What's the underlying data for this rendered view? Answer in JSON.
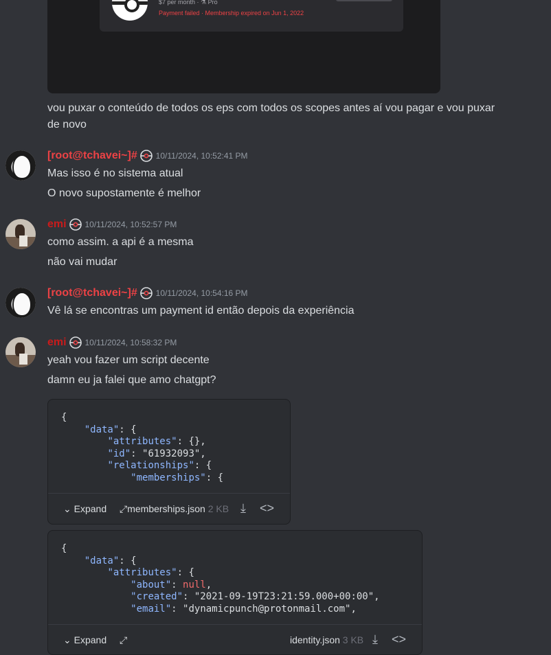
{
  "embed": {
    "price_line": "$7 per month · ",
    "tier": "Pro",
    "error_line": "Payment failed · Membership expired on Jun 1, 2022"
  },
  "messages": [
    {
      "id": "m0",
      "lines": [
        "vou puxar o conteúdo de todos os eps com todos os scopes antes aí vou pagar e vou puxar",
        "de novo"
      ]
    },
    {
      "id": "m1",
      "author": "[root@tchavei~]#",
      "timestamp": "10/11/2024, 10:52:41 PM",
      "lines": [
        "Mas isso é no sistema atual",
        "O novo supostamente é melhor"
      ]
    },
    {
      "id": "m2",
      "author": "emi",
      "timestamp": "10/11/2024, 10:52:57 PM",
      "lines": [
        "como assim. a api é a mesma",
        "não vai mudar"
      ]
    },
    {
      "id": "m3",
      "author": "[root@tchavei~]#",
      "timestamp": "10/11/2024, 10:54:16 PM",
      "lines": [
        "Vê lá se encontras um payment id então depois da experiência"
      ]
    },
    {
      "id": "m4",
      "author": "emi",
      "timestamp": "10/11/2024, 10:58:32 PM",
      "lines": [
        "yeah vou fazer um script decente",
        "damn eu ja falei que amo chatgpt?"
      ]
    }
  ],
  "attachments": [
    {
      "filename": "memberships.json",
      "size": "2 KB",
      "expand_label": "Expand",
      "code": [
        "{",
        "    \"data\": {",
        "        \"attributes\": {},",
        "        \"id\": \"61932093\",",
        "        \"relationships\": {",
        "            \"memberships\": {"
      ]
    },
    {
      "filename": "identity.json",
      "size": "3 KB",
      "expand_label": "Expand",
      "code": [
        "{",
        "    \"data\": {",
        "        \"attributes\": {",
        "            \"about\": null,",
        "            \"created\": \"2021-09-19T23:21:59.000+00:00\",",
        "            \"email\": \"dynamicpunch@protonmail.com\","
      ]
    }
  ],
  "colors": {
    "background": "#313338",
    "root_name": "#ed4245",
    "emi_name": "#c91b1b",
    "code_key": "#8fb7ff",
    "code_null": "#f16b6b"
  }
}
